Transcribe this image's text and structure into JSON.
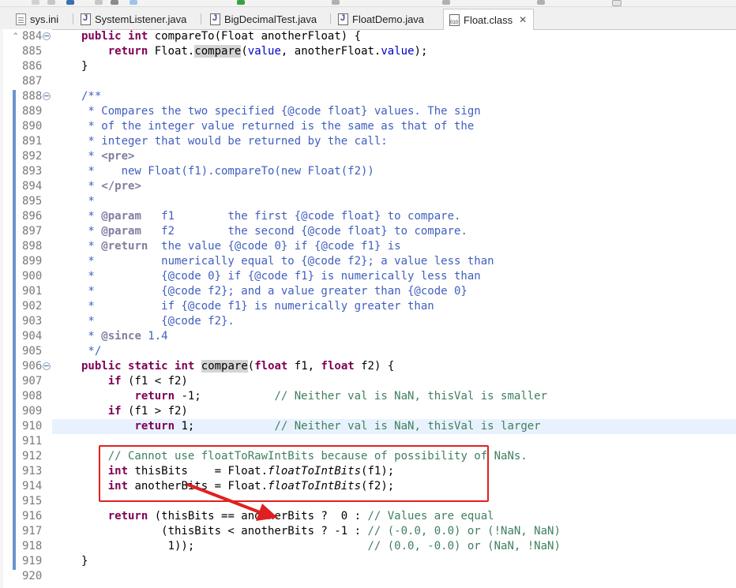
{
  "tabs": [
    {
      "label": "sys.ini",
      "icon": "ini-file-icon",
      "active": false
    },
    {
      "label": "SystemListener.java",
      "icon": "java-file-icon",
      "active": false
    },
    {
      "label": "BigDecimalTest.java",
      "icon": "java-file-icon",
      "active": false
    },
    {
      "label": "FloatDemo.java",
      "icon": "java-file-icon",
      "active": false
    },
    {
      "label": "Float.class",
      "icon": "class-file-icon",
      "active": true,
      "close": "✕"
    }
  ],
  "line_numbers": [
    "884",
    "885",
    "886",
    "887",
    "888",
    "889",
    "890",
    "891",
    "892",
    "893",
    "894",
    "895",
    "896",
    "897",
    "898",
    "899",
    "900",
    "901",
    "902",
    "903",
    "904",
    "905",
    "906",
    "907",
    "908",
    "909",
    "910",
    "911",
    "912",
    "913",
    "914",
    "915",
    "916",
    "917",
    "918",
    "919",
    "920"
  ],
  "code_lines": [
    [
      [
        "kw",
        "public"
      ],
      [
        "t",
        " "
      ],
      [
        "kw",
        "int"
      ],
      [
        "t",
        " compareTo(Float anotherFloat) {"
      ]
    ],
    [
      [
        "t",
        "    "
      ],
      [
        "kw",
        "return"
      ],
      [
        "t",
        " Float."
      ],
      [
        "hl",
        "compare"
      ],
      [
        "t",
        "("
      ],
      [
        "fld",
        "value"
      ],
      [
        "t",
        ", anotherFloat."
      ],
      [
        "fld",
        "value"
      ],
      [
        "t",
        ");"
      ]
    ],
    [
      [
        "t",
        "}"
      ]
    ],
    [
      [
        "t",
        ""
      ]
    ],
    [
      [
        "jd",
        "/**"
      ]
    ],
    [
      [
        "jd",
        " * Compares the two specified {@code float} values. The sign"
      ]
    ],
    [
      [
        "jd",
        " * of the integer value returned is the same as that of the"
      ]
    ],
    [
      [
        "jd",
        " * integer that would be returned by the call:"
      ]
    ],
    [
      [
        "jd",
        " * "
      ],
      [
        "tag",
        "<pre>"
      ]
    ],
    [
      [
        "jd",
        " *    new Float(f1).compareTo(new Float(f2))"
      ]
    ],
    [
      [
        "jd",
        " * "
      ],
      [
        "tag",
        "</pre>"
      ]
    ],
    [
      [
        "jd",
        " *"
      ]
    ],
    [
      [
        "jd",
        " * "
      ],
      [
        "tag",
        "@param"
      ],
      [
        "jd",
        "   f1        the first {@code float} to compare."
      ]
    ],
    [
      [
        "jd",
        " * "
      ],
      [
        "tag",
        "@param"
      ],
      [
        "jd",
        "   f2        the second {@code float} to compare."
      ]
    ],
    [
      [
        "jd",
        " * "
      ],
      [
        "tag",
        "@return"
      ],
      [
        "jd",
        "  the value {@code 0} if {@code f1} is"
      ]
    ],
    [
      [
        "jd",
        " *          numerically equal to {@code f2}; a value less than"
      ]
    ],
    [
      [
        "jd",
        " *          {@code 0} if {@code f1} is numerically less than"
      ]
    ],
    [
      [
        "jd",
        " *          {@code f2}; and a value greater than {@code 0}"
      ]
    ],
    [
      [
        "jd",
        " *          if {@code f1} is numerically greater than"
      ]
    ],
    [
      [
        "jd",
        " *          {@code f2}."
      ]
    ],
    [
      [
        "jd",
        " * "
      ],
      [
        "tag",
        "@since"
      ],
      [
        "jd",
        " 1.4"
      ]
    ],
    [
      [
        "jd",
        " */"
      ]
    ],
    [
      [
        "kw",
        "public"
      ],
      [
        "t",
        " "
      ],
      [
        "kw",
        "static"
      ],
      [
        "t",
        " "
      ],
      [
        "kw",
        "int"
      ],
      [
        "t",
        " "
      ],
      [
        "hl",
        "compare"
      ],
      [
        "t",
        "("
      ],
      [
        "kw",
        "float"
      ],
      [
        "t",
        " f1, "
      ],
      [
        "kw",
        "float"
      ],
      [
        "t",
        " f2) {"
      ]
    ],
    [
      [
        "t",
        "    "
      ],
      [
        "kw",
        "if"
      ],
      [
        "t",
        " (f1 < f2)"
      ]
    ],
    [
      [
        "t",
        "        "
      ],
      [
        "kw",
        "return"
      ],
      [
        "t",
        " -1;           "
      ],
      [
        "cm",
        "// Neither val is NaN, thisVal is smaller"
      ]
    ],
    [
      [
        "t",
        "    "
      ],
      [
        "kw",
        "if"
      ],
      [
        "t",
        " (f1 > f2)"
      ]
    ],
    [
      [
        "t",
        "        "
      ],
      [
        "kw",
        "return"
      ],
      [
        "t",
        " 1;            "
      ],
      [
        "cm",
        "// Neither val is NaN, thisVal is larger"
      ]
    ],
    [
      [
        "t",
        ""
      ]
    ],
    [
      [
        "t",
        "    "
      ],
      [
        "cm",
        "// Cannot use floatToRawIntBits because of possibility of NaNs."
      ]
    ],
    [
      [
        "t",
        "    "
      ],
      [
        "kw",
        "int"
      ],
      [
        "t",
        " thisBits    = Float."
      ],
      [
        "ital",
        "floatToIntBits"
      ],
      [
        "t",
        "(f1);"
      ]
    ],
    [
      [
        "t",
        "    "
      ],
      [
        "kw",
        "int"
      ],
      [
        "t",
        " anotherBits = Float."
      ],
      [
        "ital",
        "floatToIntBits"
      ],
      [
        "t",
        "(f2);"
      ]
    ],
    [
      [
        "t",
        ""
      ]
    ],
    [
      [
        "t",
        "    "
      ],
      [
        "kw",
        "return"
      ],
      [
        "t",
        " (thisBits == anotherBits ?  0 : "
      ],
      [
        "cm",
        "// Values are equal"
      ]
    ],
    [
      [
        "t",
        "            (thisBits < anotherBits ? -1 : "
      ],
      [
        "cm",
        "// (-0.0, 0.0) or (!NaN, NaN)"
      ]
    ],
    [
      [
        "t",
        "             1));                          "
      ],
      [
        "cm",
        "// (0.0, -0.0) or (NaN, !NaN)"
      ]
    ],
    [
      [
        "t",
        "}"
      ]
    ],
    [
      [
        "t",
        ""
      ]
    ]
  ],
  "current_line_index": 26,
  "folded_line_indexes": [
    0,
    4,
    22
  ],
  "colors": {
    "keyword": "#7f0055",
    "javadoc": "#3f5fbf",
    "javadoc_tag": "#7f7f9f",
    "comment": "#3f7f5f",
    "field": "#0000c0",
    "annotation_box": "#e02020",
    "current_line": "#e8f2fe"
  }
}
